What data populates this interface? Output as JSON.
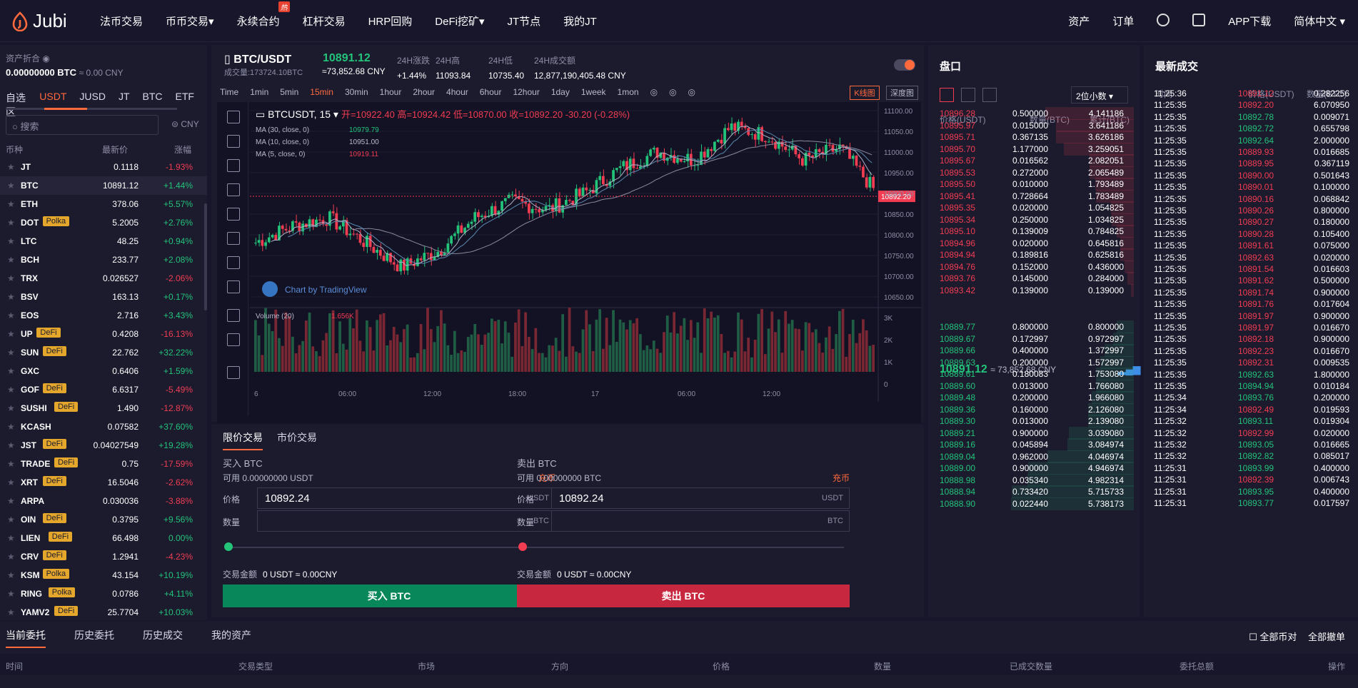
{
  "brand": "Jubi",
  "nav": [
    "法币交易",
    "币币交易",
    "永续合约",
    "杠杆交易",
    "HRP回购",
    "DeFi挖矿",
    "JT节点",
    "我的JT"
  ],
  "nav_hot": "热",
  "right_nav": [
    "资产",
    "订单",
    "APP下载",
    "简体中文"
  ],
  "asset": {
    "label": "资产折合",
    "value": "0.00000000 BTC",
    "cny": "≈ 0.00 CNY"
  },
  "market_tabs": [
    "自选区",
    "USDT",
    "JUSD",
    "JT",
    "BTC",
    "ETF"
  ],
  "search_placeholder": "搜索",
  "cny_toggle": "CNY",
  "list_head": {
    "coin": "币种",
    "price": "最新价",
    "change": "涨幅"
  },
  "coins": [
    {
      "name": "JT",
      "tag": "",
      "price": "0.1118",
      "change": "-1.93%",
      "dir": "dn"
    },
    {
      "name": "BTC",
      "tag": "",
      "price": "10891.12",
      "change": "+1.44%",
      "dir": "up"
    },
    {
      "name": "ETH",
      "tag": "",
      "price": "378.06",
      "change": "+5.57%",
      "dir": "up"
    },
    {
      "name": "DOT",
      "tag": "Polka",
      "price": "5.2005",
      "change": "+2.76%",
      "dir": "up"
    },
    {
      "name": "LTC",
      "tag": "",
      "price": "48.25",
      "change": "+0.94%",
      "dir": "up"
    },
    {
      "name": "BCH",
      "tag": "",
      "price": "233.77",
      "change": "+2.08%",
      "dir": "up"
    },
    {
      "name": "TRX",
      "tag": "",
      "price": "0.026527",
      "change": "-2.06%",
      "dir": "dn"
    },
    {
      "name": "BSV",
      "tag": "",
      "price": "163.13",
      "change": "+0.17%",
      "dir": "up"
    },
    {
      "name": "EOS",
      "tag": "",
      "price": "2.716",
      "change": "+3.43%",
      "dir": "up"
    },
    {
      "name": "UP",
      "tag": "DeFi",
      "price": "0.4208",
      "change": "-16.13%",
      "dir": "dn"
    },
    {
      "name": "SUN",
      "tag": "DeFi",
      "price": "22.762",
      "change": "+32.22%",
      "dir": "up"
    },
    {
      "name": "GXC",
      "tag": "",
      "price": "0.6406",
      "change": "+1.59%",
      "dir": "up"
    },
    {
      "name": "GOF",
      "tag": "DeFi",
      "price": "6.6317",
      "change": "-5.49%",
      "dir": "dn"
    },
    {
      "name": "SUSHI",
      "tag": "DeFi",
      "price": "1.490",
      "change": "-12.87%",
      "dir": "dn"
    },
    {
      "name": "KCASH",
      "tag": "",
      "price": "0.07582",
      "change": "+37.60%",
      "dir": "up"
    },
    {
      "name": "JST",
      "tag": "DeFi",
      "price": "0.04027549",
      "change": "+19.28%",
      "dir": "up"
    },
    {
      "name": "TRADE",
      "tag": "DeFi",
      "price": "0.75",
      "change": "-17.59%",
      "dir": "dn"
    },
    {
      "name": "XRT",
      "tag": "DeFi",
      "price": "16.5046",
      "change": "-2.62%",
      "dir": "dn"
    },
    {
      "name": "ARPA",
      "tag": "",
      "price": "0.030036",
      "change": "-3.88%",
      "dir": "dn"
    },
    {
      "name": "OIN",
      "tag": "DeFi",
      "price": "0.3795",
      "change": "+9.56%",
      "dir": "up"
    },
    {
      "name": "LIEN",
      "tag": "DeFi",
      "price": "66.498",
      "change": "0.00%",
      "dir": "up"
    },
    {
      "name": "CRV",
      "tag": "DeFi",
      "price": "1.2941",
      "change": "-4.23%",
      "dir": "dn"
    },
    {
      "name": "KSM",
      "tag": "Polka",
      "price": "43.154",
      "change": "+10.19%",
      "dir": "up"
    },
    {
      "name": "RING",
      "tag": "Polka",
      "price": "0.0786",
      "change": "+4.11%",
      "dir": "up"
    },
    {
      "name": "YAMV2",
      "tag": "DeFi",
      "price": "25.7704",
      "change": "+10.03%",
      "dir": "up"
    }
  ],
  "ticker": {
    "pair": "BTC/USDT",
    "volume": "成交量:173724.10BTC",
    "last": "10891.12",
    "cny": "≈73,852.68 CNY",
    "stats": [
      {
        "k": "24H涨跌",
        "v": "+1.44%"
      },
      {
        "k": "24H高",
        "v": "11093.84"
      },
      {
        "k": "24H低",
        "v": "10735.40"
      },
      {
        "k": "24H成交额",
        "v": "12,877,190,405.48 CNY"
      }
    ]
  },
  "timeframes": [
    "Time",
    "1min",
    "5min",
    "15min",
    "30min",
    "1hour",
    "2hour",
    "4hour",
    "6hour",
    "12hour",
    "1day",
    "1week",
    "1mon"
  ],
  "chart_buttons": [
    "K线图",
    "深度图"
  ],
  "chart_legend": {
    "symbol": "BTCUSDT, 15",
    "ohlc": "开=10922.40  高=10924.42  低=10870.00  收=10892.20  -30.20 (-0.28%)",
    "ma": [
      {
        "l": "MA (30, close, 0)",
        "v": "10979.79"
      },
      {
        "l": "MA (10, close, 0)",
        "v": "10951.00"
      },
      {
        "l": "MA (5, close, 0)",
        "v": "10919.11"
      }
    ],
    "volume": "Volume (20)",
    "volume_v": "1.656K",
    "watermark": "Chart by TradingView",
    "price_tag": "10892.20"
  },
  "chart_axis": {
    "price": [
      "11100.00",
      "11050.00",
      "11000.00",
      "10950.00",
      "10900.00",
      "10850.00",
      "10800.00",
      "10750.00",
      "10700.00",
      "10650.00"
    ],
    "vol": [
      "3K",
      "2K",
      "1K",
      "0"
    ],
    "time": [
      "6",
      "06:00",
      "12:00",
      "18:00",
      "17",
      "06:00",
      "12:00"
    ]
  },
  "trade": {
    "tabs": [
      "限价交易",
      "市价交易"
    ],
    "buy": {
      "title": "买入 BTC",
      "avail": "可用 0.00000000 USDT",
      "charge": "充币",
      "price_label": "价格",
      "price": "10892.24",
      "price_unit": "USDT",
      "qty_label": "数量",
      "qty_unit": "BTC",
      "amount_label": "交易金额",
      "amount": "0 USDT ≈ 0.00CNY",
      "btn": "买入 BTC"
    },
    "sell": {
      "title": "卖出 BTC",
      "avail": "可用 0.00000000 BTC",
      "charge": "充币",
      "price_label": "价格",
      "price": "10892.24",
      "price_unit": "USDT",
      "qty_label": "数量",
      "qty_unit": "BTC",
      "amount_label": "交易金额",
      "amount": "0 USDT ≈ 0.00CNY",
      "btn": "卖出 BTC"
    }
  },
  "book": {
    "title": "盘口",
    "decimals": "2位小数",
    "head": [
      "价格(USDT)",
      "数量(BTC)",
      "累计(BTC)"
    ],
    "asks": [
      [
        "10896.28",
        "0.500000",
        "4.141186"
      ],
      [
        "10895.97",
        "0.015000",
        "3.641186"
      ],
      [
        "10895.71",
        "0.367135",
        "3.626186"
      ],
      [
        "10895.70",
        "1.177000",
        "3.259051"
      ],
      [
        "10895.67",
        "0.016562",
        "2.082051"
      ],
      [
        "10895.53",
        "0.272000",
        "2.065489"
      ],
      [
        "10895.50",
        "0.010000",
        "1.793489"
      ],
      [
        "10895.41",
        "0.728664",
        "1.783489"
      ],
      [
        "10895.35",
        "0.020000",
        "1.054825"
      ],
      [
        "10895.34",
        "0.250000",
        "1.034825"
      ],
      [
        "10895.10",
        "0.139009",
        "0.784825"
      ],
      [
        "10894.96",
        "0.020000",
        "0.645816"
      ],
      [
        "10894.94",
        "0.189816",
        "0.625816"
      ],
      [
        "10894.76",
        "0.152000",
        "0.436000"
      ],
      [
        "10893.76",
        "0.145000",
        "0.284000"
      ],
      [
        "10893.42",
        "0.139000",
        "0.139000"
      ]
    ],
    "mid": "10891.12",
    "mid_cny": "≈ 73,852.68 CNY",
    "bids": [
      [
        "10889.77",
        "0.800000",
        "0.800000"
      ],
      [
        "10889.67",
        "0.172997",
        "0.972997"
      ],
      [
        "10889.66",
        "0.400000",
        "1.372997"
      ],
      [
        "10889.63",
        "0.200000",
        "1.572997"
      ],
      [
        "10889.61",
        "0.180083",
        "1.753080"
      ],
      [
        "10889.60",
        "0.013000",
        "1.766080"
      ],
      [
        "10889.48",
        "0.200000",
        "1.966080"
      ],
      [
        "10889.36",
        "0.160000",
        "2.126080"
      ],
      [
        "10889.30",
        "0.013000",
        "2.139080"
      ],
      [
        "10889.21",
        "0.900000",
        "3.039080"
      ],
      [
        "10889.16",
        "0.045894",
        "3.084974"
      ],
      [
        "10889.04",
        "0.962000",
        "4.046974"
      ],
      [
        "10889.00",
        "0.900000",
        "4.946974"
      ],
      [
        "10888.98",
        "0.035340",
        "4.982314"
      ],
      [
        "10888.94",
        "0.733420",
        "5.715733"
      ],
      [
        "10888.90",
        "0.022440",
        "5.738173"
      ]
    ]
  },
  "trades": {
    "title": "最新成交",
    "head": [
      "时间",
      "价格(USDT)",
      "数量(BTC)"
    ],
    "rows": [
      [
        "11:25:36",
        "10891.12",
        "0.282256",
        "dn"
      ],
      [
        "11:25:35",
        "10892.20",
        "6.070950",
        "dn"
      ],
      [
        "11:25:35",
        "10892.78",
        "0.009071",
        "up"
      ],
      [
        "11:25:35",
        "10892.72",
        "0.655798",
        "up"
      ],
      [
        "11:25:35",
        "10892.64",
        "2.000000",
        "up"
      ],
      [
        "11:25:35",
        "10889.93",
        "0.016685",
        "dn"
      ],
      [
        "11:25:35",
        "10889.95",
        "0.367119",
        "dn"
      ],
      [
        "11:25:35",
        "10890.00",
        "0.501643",
        "dn"
      ],
      [
        "11:25:35",
        "10890.01",
        "0.100000",
        "dn"
      ],
      [
        "11:25:35",
        "10890.16",
        "0.068842",
        "dn"
      ],
      [
        "11:25:35",
        "10890.26",
        "0.800000",
        "dn"
      ],
      [
        "11:25:35",
        "10890.27",
        "0.180000",
        "dn"
      ],
      [
        "11:25:35",
        "10890.28",
        "0.105400",
        "dn"
      ],
      [
        "11:25:35",
        "10891.61",
        "0.075000",
        "dn"
      ],
      [
        "11:25:35",
        "10892.63",
        "0.020000",
        "dn"
      ],
      [
        "11:25:35",
        "10891.54",
        "0.016603",
        "dn"
      ],
      [
        "11:25:35",
        "10891.62",
        "0.500000",
        "dn"
      ],
      [
        "11:25:35",
        "10891.74",
        "0.900000",
        "dn"
      ],
      [
        "11:25:35",
        "10891.76",
        "0.017604",
        "dn"
      ],
      [
        "11:25:35",
        "10891.97",
        "0.900000",
        "dn"
      ],
      [
        "11:25:35",
        "10891.97",
        "0.016670",
        "dn"
      ],
      [
        "11:25:35",
        "10892.18",
        "0.900000",
        "dn"
      ],
      [
        "11:25:35",
        "10892.23",
        "0.016670",
        "dn"
      ],
      [
        "11:25:35",
        "10892.31",
        "0.009535",
        "dn"
      ],
      [
        "11:25:35",
        "10892.63",
        "1.800000",
        "up"
      ],
      [
        "11:25:35",
        "10894.94",
        "0.010184",
        "up"
      ],
      [
        "11:25:34",
        "10893.76",
        "0.200000",
        "up"
      ],
      [
        "11:25:34",
        "10892.49",
        "0.019593",
        "dn"
      ],
      [
        "11:25:32",
        "10893.11",
        "0.019304",
        "up"
      ],
      [
        "11:25:32",
        "10892.99",
        "0.020000",
        "dn"
      ],
      [
        "11:25:32",
        "10893.05",
        "0.016665",
        "up"
      ],
      [
        "11:25:32",
        "10892.82",
        "0.085017",
        "up"
      ],
      [
        "11:25:31",
        "10893.99",
        "0.400000",
        "up"
      ],
      [
        "11:25:31",
        "10892.39",
        "0.006743",
        "dn"
      ],
      [
        "11:25:31",
        "10893.95",
        "0.400000",
        "up"
      ],
      [
        "11:25:31",
        "10893.77",
        "0.017597",
        "up"
      ]
    ]
  },
  "bottom": {
    "tabs": [
      "当前委托",
      "历史委托",
      "历史成交",
      "我的资产"
    ],
    "all_pairs": "全部币对",
    "cancel_all": "全部撤单",
    "cols": [
      "时间",
      "交易类型",
      "市场",
      "方向",
      "价格",
      "数量",
      "已成交数量",
      "委托总额",
      "操作"
    ]
  },
  "colors": {
    "up": "#23c37a",
    "down": "#f23c52",
    "accent": "#ff6a3d",
    "buy": "#07875a",
    "sell": "#c8283f"
  }
}
